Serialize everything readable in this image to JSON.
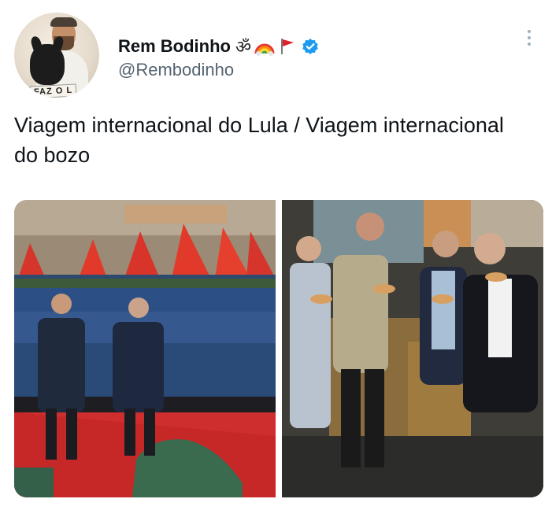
{
  "author": {
    "display_name": "Rem Bodinho",
    "name_emoji": "ॐ",
    "handle": "@Rembodinho",
    "avatar_tag": "FAZ O L",
    "verified_color": "#1d9bf0"
  },
  "tweet": {
    "text": "Viagem internacional do Lula / Viagem internacional do bozo"
  },
  "media": [
    {
      "name": "left-photo",
      "description_icon": "photo-icon"
    },
    {
      "name": "right-photo",
      "description_icon": "photo-icon"
    }
  ],
  "colors": {
    "text": "#0f1419",
    "secondary": "#536471",
    "accent": "#1d9bf0"
  }
}
